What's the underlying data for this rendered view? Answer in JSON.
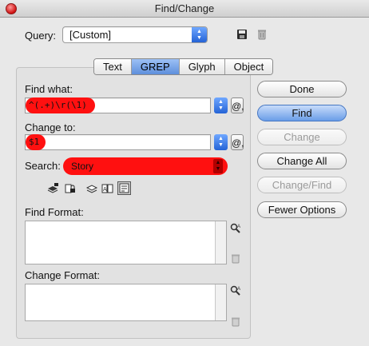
{
  "window": {
    "title": "Find/Change"
  },
  "query": {
    "label": "Query:",
    "value": "[Custom]"
  },
  "tabs": [
    {
      "label": "Text",
      "active": false
    },
    {
      "label": "GREP",
      "active": true
    },
    {
      "label": "Glyph",
      "active": false
    },
    {
      "label": "Object",
      "active": false
    }
  ],
  "find_what": {
    "label": "Find what:",
    "value": "^(.+)\\r(\\1)"
  },
  "change_to": {
    "label": "Change to:",
    "value": "$1"
  },
  "search": {
    "label": "Search:",
    "value": "Story"
  },
  "find_format": {
    "label": "Find Format:"
  },
  "change_format": {
    "label": "Change Format:"
  },
  "buttons": {
    "done": "Done",
    "find": "Find",
    "change": "Change",
    "change_all": "Change All",
    "change_find": "Change/Find",
    "fewer_options": "Fewer Options"
  },
  "special_char_symbol": "@,",
  "colors": {
    "highlight": "#ff1010",
    "selected_tab": "#7aa6e8",
    "default_button": "#6a9de8"
  }
}
